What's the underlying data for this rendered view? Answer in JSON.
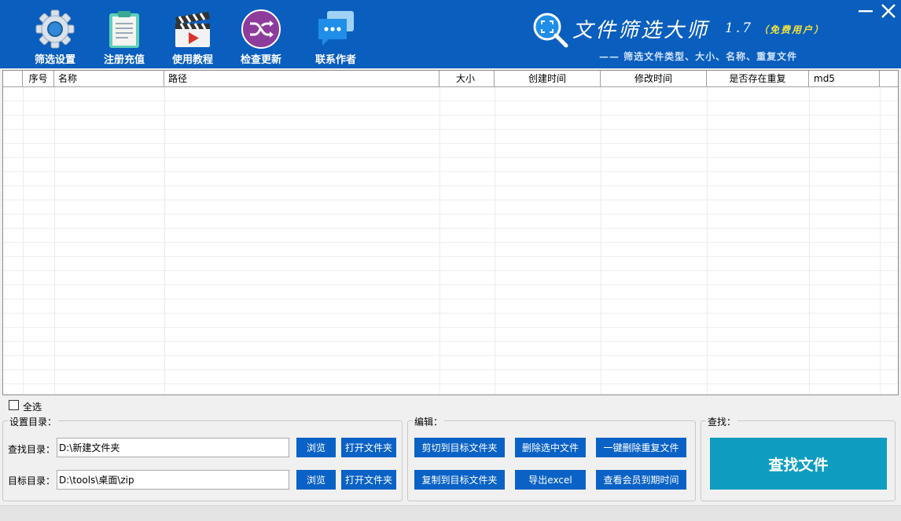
{
  "toolbar": {
    "filter_settings": "筛选设置",
    "register_recharge": "注册充值",
    "tutorial": "使用教程",
    "check_update": "检查更新",
    "contact_author": "联系作者"
  },
  "branding": {
    "title": "文件筛选大师",
    "version": "1.7",
    "edition": "（免费用户）",
    "slogan": "—— 筛选文件类型、大小、名称、重复文件"
  },
  "window_controls": {
    "minimize": "—",
    "close": "✕"
  },
  "table": {
    "columns": [
      "序号",
      "名称",
      "路径",
      "大小",
      "创建时间",
      "修改时间",
      "是否存在重复",
      "md5"
    ],
    "rows": []
  },
  "select_all": {
    "label": "全选",
    "checked": false
  },
  "directory_panel": {
    "title": "设置目录：",
    "search_label": "查找目录：",
    "search_value": "D:\\新建文件夹",
    "target_label": "目标目录：",
    "target_value": "D:\\tools\\桌面\\zip",
    "browse_label": "浏览",
    "open_folder_label": "打开文件夹"
  },
  "edit_panel": {
    "title": "编辑：",
    "cut_to_target": "剪切到目标文件夹",
    "delete_selected": "删除选中文件",
    "delete_duplicates": "一键删除重复文件",
    "copy_to_target": "复制到目标文件夹",
    "export_excel": "导出excel",
    "check_membership": "查看会员到期时间"
  },
  "search_panel": {
    "title": "查找：",
    "find_button": "查找文件"
  },
  "colors": {
    "header_bg": "#0a5ebe",
    "button_bg": "#0a62c6",
    "find_button_bg": "#0e9dc0",
    "edition_text": "#f5e33a"
  },
  "icons": {
    "filter_settings": "gear-icon",
    "register_recharge": "notepad-icon",
    "tutorial": "clapperboard-icon",
    "check_update": "shuffle-icon",
    "contact_author": "chat-bubble-icon",
    "logo": "magnifier-icon"
  }
}
